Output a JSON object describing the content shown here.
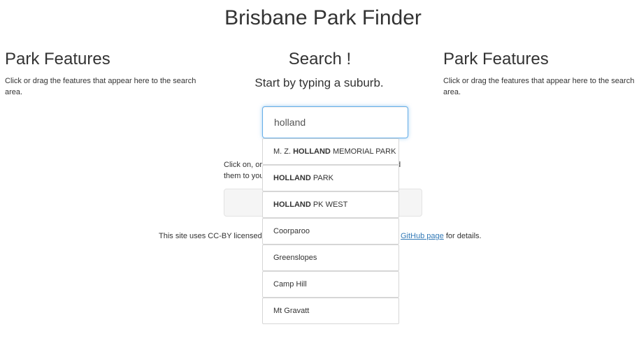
{
  "header": {
    "title": "Brisbane Park Finder"
  },
  "left_panel": {
    "heading": "Park Features",
    "description": "Click or drag the features that appear here to the search area."
  },
  "right_panel": {
    "heading": "Park Features",
    "description": "Click or drag the features that appear here to the search area."
  },
  "search": {
    "heading": "Search !",
    "subtitle": "Start by typing a suburb.",
    "value": "holland",
    "instructions_left_1": "Click on, or",
    "instructions_right_1": "d",
    "instructions_left_2": "them to you"
  },
  "suggestions": [
    {
      "prefix": "M. Z. ",
      "match": "HOLLAND",
      "suffix": " MEMORIAL PARK"
    },
    {
      "prefix": "",
      "match": "HOLLAND",
      "suffix": " PARK"
    },
    {
      "prefix": "",
      "match": "HOLLAND",
      "suffix": " PK WEST"
    },
    {
      "prefix": "Coorparoo",
      "match": "",
      "suffix": ""
    },
    {
      "prefix": "Greenslopes",
      "match": "",
      "suffix": ""
    },
    {
      "prefix": "Camp Hill",
      "match": "",
      "suffix": ""
    },
    {
      "prefix": "Mt Gravatt",
      "match": "",
      "suffix": ""
    }
  ],
  "footer": {
    "left_text": "This site uses CC-BY licensed",
    "link_text": "GitHub page",
    "right_text": " for details."
  }
}
